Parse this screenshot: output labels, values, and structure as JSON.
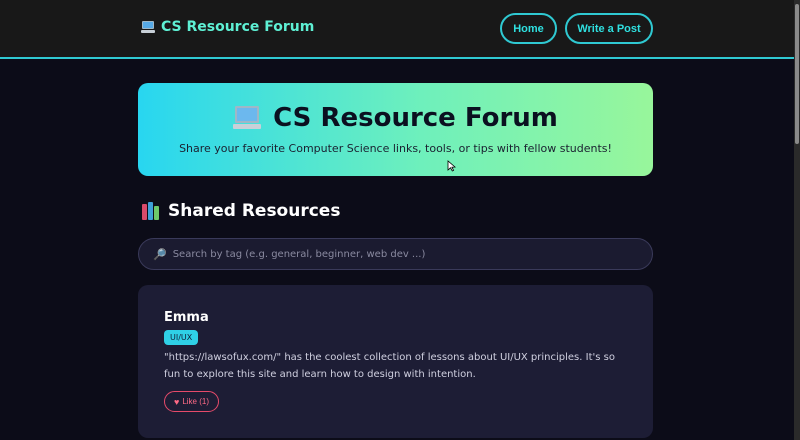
{
  "navbar": {
    "brand": "CS Resource Forum",
    "home_label": "Home",
    "write_label": "Write a Post"
  },
  "hero": {
    "title": "CS Resource Forum",
    "subtitle": "Share your favorite Computer Science links, tools, or tips with fellow students!"
  },
  "section": {
    "title": "Shared Resources"
  },
  "search": {
    "placeholder": "Search by tag (e.g. general, beginner, web dev ...)"
  },
  "posts": [
    {
      "author": "Emma",
      "tag": "UI/UX",
      "body": "\"https://lawsofux.com/\" has the coolest collection of lessons about UI/UX principles. It's so fun to explore this site and learn how to design with intention.",
      "like_label": "Like (1)"
    }
  ],
  "icons": {
    "brand": "laptop-icon",
    "section": "books-icon",
    "search": "magnifier-icon",
    "like": "heart-icon"
  },
  "colors": {
    "accent": "#2fc9d2",
    "brand_text": "#5ef0d4",
    "hero_gradient_start": "#28d6f0",
    "hero_gradient_end": "#98f69b",
    "like": "#e64a6a",
    "background": "#0c0c18",
    "card": "#1d1d35"
  }
}
